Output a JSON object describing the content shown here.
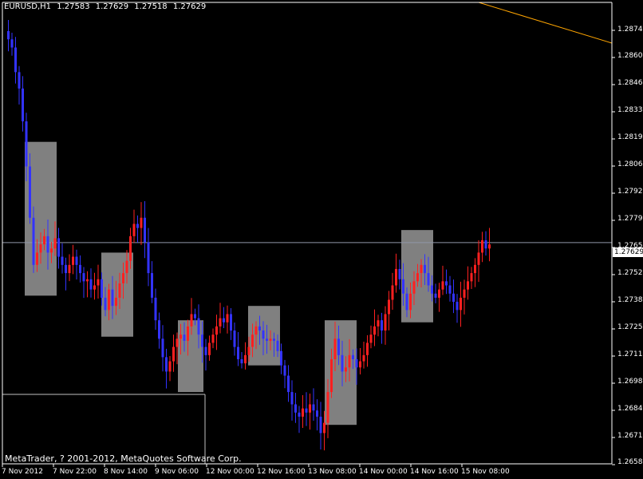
{
  "header": {
    "symbol": "EURUSD,H1",
    "open": "1.27583",
    "high": "1.27629",
    "low": "1.27518",
    "close": "1.27629"
  },
  "footer": {
    "copyright": "MetaTrader, ? 2001-2012, MetaQuotes Software Corp."
  },
  "colors": {
    "background": "#000000",
    "bull": "#ff2020",
    "bear": "#3333ff",
    "rectangle": "#808080",
    "trendline": "#ffa500",
    "axis": "#ffffff",
    "price_line": "#8f96a8"
  },
  "price_axis": {
    "ticks": [
      "1.28740",
      "1.28600",
      "1.28465",
      "1.28330",
      "1.28195",
      "1.28060",
      "1.27925",
      "1.27790",
      "1.27655",
      "1.27520",
      "1.27385",
      "1.27250",
      "1.27115",
      "1.26980",
      "1.26845",
      "1.26710",
      "1.26580"
    ],
    "current_price": "1.27629"
  },
  "time_axis": {
    "ticks": [
      "7 Nov 2012",
      "7 Nov 22:00",
      "8 Nov 14:00",
      "9 Nov 06:00",
      "12 Nov 00:00",
      "12 Nov 16:00",
      "13 Nov 08:00",
      "14 Nov 00:00",
      "14 Nov 16:00",
      "15 Nov 08:00"
    ]
  },
  "chart_data": {
    "type": "candlestick",
    "symbol": "EURUSD",
    "timeframe": "H1",
    "ylim": [
      1.2655,
      1.288
    ],
    "grid": false,
    "series_path": [
      1.2866,
      1.2862,
      1.2858,
      1.2846,
      1.2838,
      1.2822,
      1.28,
      1.2775,
      1.2752,
      1.2758,
      1.2762,
      1.2766,
      1.2758,
      1.276,
      1.2765,
      1.2756,
      1.2752,
      1.2748,
      1.2752,
      1.2756,
      1.2752,
      1.2748,
      1.2744,
      1.2745,
      1.274,
      1.2742,
      1.2745,
      1.2736,
      1.273,
      1.274,
      1.2732,
      1.2736,
      1.2743,
      1.2748,
      1.2754,
      1.2766,
      1.2772,
      1.277,
      1.2775,
      1.2763,
      1.2748,
      1.2736,
      1.2725,
      1.2716,
      1.2707,
      1.27,
      1.2705,
      1.2712,
      1.2716,
      1.2718,
      1.2715,
      1.2722,
      1.2728,
      1.2726,
      1.2718,
      1.2712,
      1.2708,
      1.2714,
      1.2718,
      1.2722,
      1.2726,
      1.2724,
      1.2728,
      1.272,
      1.2712,
      1.2706,
      1.2704,
      1.2708,
      1.2712,
      1.2718,
      1.2722,
      1.272,
      1.2716,
      1.2715,
      1.2716,
      1.2715,
      1.271,
      1.2703,
      1.2698,
      1.269,
      1.2684,
      1.268,
      1.2678,
      1.2682,
      1.268,
      1.2684,
      1.2681,
      1.2678,
      1.267,
      1.2675,
      1.269,
      1.2706,
      1.2716,
      1.2708,
      1.27,
      1.2702,
      1.2708,
      1.2706,
      1.2702,
      1.2705,
      1.2708,
      1.2714,
      1.2718,
      1.2722,
      1.2725,
      1.272,
      1.2728,
      1.2735,
      1.2742,
      1.275,
      1.2745,
      1.2738,
      1.273,
      1.2738,
      1.2744,
      1.2748,
      1.2752,
      1.2748,
      1.2742,
      1.2738,
      1.2736,
      1.274,
      1.2744,
      1.2742,
      1.2738,
      1.2734,
      1.273,
      1.2736,
      1.274,
      1.2744,
      1.2748,
      1.2752,
      1.2758,
      1.2764,
      1.276,
      1.2762
    ],
    "rectangles": [
      {
        "price_top": 1.2812,
        "price_bottom": 1.2737
      },
      {
        "price_top": 1.2758,
        "price_bottom": 1.2717
      },
      {
        "price_top": 1.2725,
        "price_bottom": 1.269
      },
      {
        "price_top": 1.2732,
        "price_bottom": 1.2703
      },
      {
        "price_top": 1.2725,
        "price_bottom": 1.2674
      },
      {
        "price_top": 1.2769,
        "price_bottom": 1.2724
      }
    ],
    "trendline": {
      "color": "orange"
    },
    "horizontal_lines": [
      1.27629,
      1.2692
    ]
  }
}
